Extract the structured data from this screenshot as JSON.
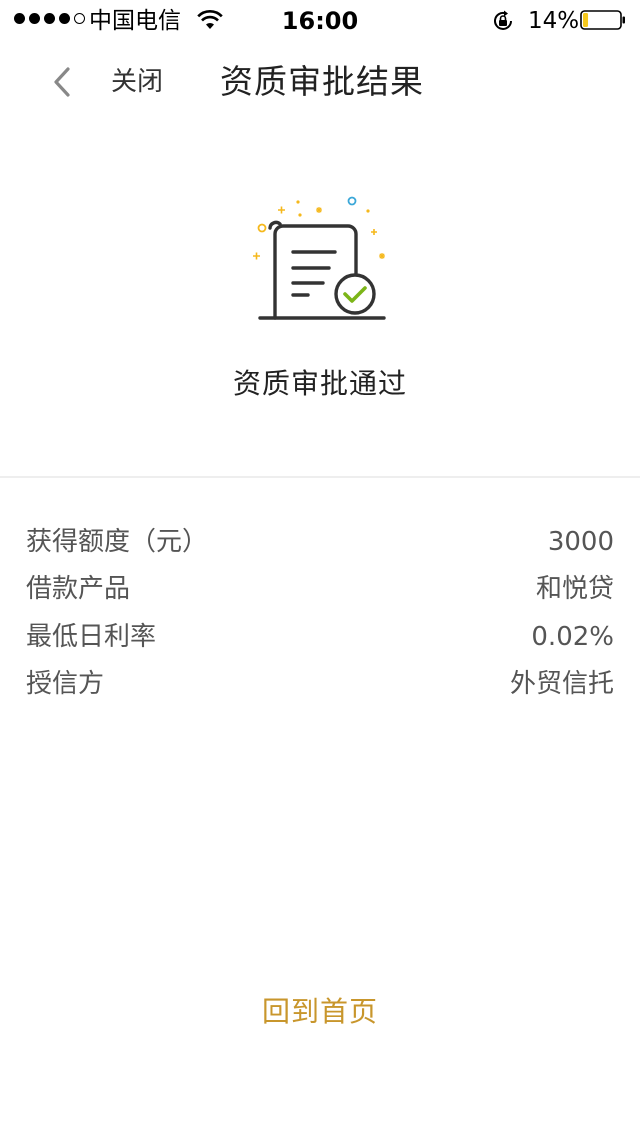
{
  "status_bar": {
    "carrier": "中国电信",
    "time": "16:00",
    "battery_percent": "14%",
    "battery_level": 0.14,
    "signal_bars_filled": 4,
    "signal_bars_total": 5,
    "icons": [
      "signal-dots-icon",
      "wifi-icon",
      "rotation-lock-icon",
      "battery-icon"
    ]
  },
  "nav": {
    "back_icon": "chevron-left-icon",
    "close_label": "关闭",
    "title": "资质审批结果"
  },
  "result": {
    "icon": "approved-document-icon",
    "title": "资质审批通过"
  },
  "details": [
    {
      "label": "获得额度（元）",
      "value": "3000"
    },
    {
      "label": "借款产品",
      "value": "和悦贷"
    },
    {
      "label": "最低日利率",
      "value": "0.02%"
    },
    {
      "label": "授信方",
      "value": "外贸信托"
    }
  ],
  "footer": {
    "home_label": "回到首页"
  },
  "colors": {
    "accent": "#c8962c",
    "check_green": "#7cb518",
    "sparkle_gold": "#f5b81c",
    "sparkle_blue": "#3aa7d8",
    "battery_fill": "#f5c81c"
  }
}
